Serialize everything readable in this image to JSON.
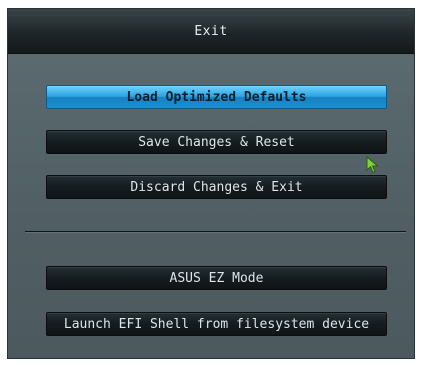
{
  "dialog": {
    "title": "Exit",
    "options": [
      {
        "label": "Load Optimized Defaults"
      },
      {
        "label": "Save Changes & Reset"
      },
      {
        "label": "Discard Changes & Exit"
      },
      {
        "label": "ASUS EZ Mode"
      },
      {
        "label": "Launch EFI Shell from filesystem device"
      }
    ],
    "selected_option": "Load Optimized Defaults"
  },
  "colors": {
    "selected_highlight": "#2aa3e0",
    "panel": "#56656a",
    "titlebar": "#1a2124",
    "cursor": "#7dd33a"
  },
  "icons": {
    "cursor": "mouse-pointer-icon"
  }
}
